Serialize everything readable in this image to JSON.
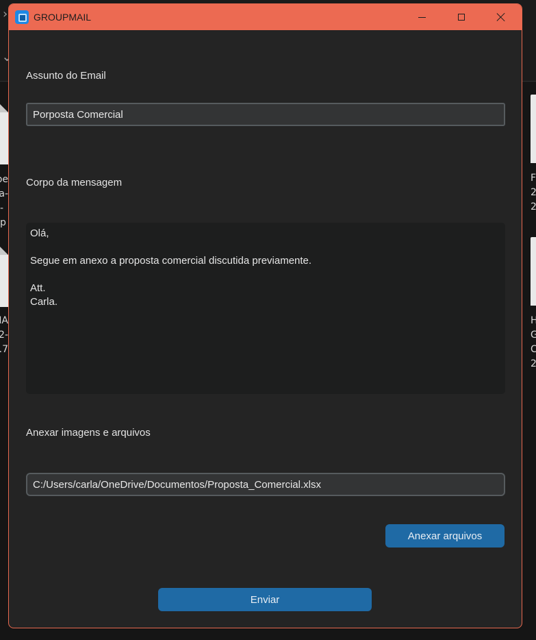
{
  "window": {
    "title": "GROUPMAIL"
  },
  "form": {
    "subject_label": "Assunto do Email",
    "subject_value": "Porposta Comercial",
    "body_label": "Corpo da mensagem",
    "body_value": "Olá,\n\nSegue em anexo a proposta comercial discutida previamente.\n\nAtt.\nCarla.",
    "attach_label": "Anexar imagens e arquivos",
    "attach_path": "C:/Users/carla/OneDrive/Documentos/Proposta_Comercial.xlsx",
    "attach_button": "Anexar arquivos",
    "send_button": "Enviar"
  },
  "background": {
    "left_texts": [
      "pe\n-sa\n-\np",
      "MA\n-2\n7."
    ],
    "right_texts": [
      "F\n2\n2",
      "H\nG\nC\n2"
    ]
  },
  "colors": {
    "titlebar": "#ec6a52",
    "window_bg": "#242424",
    "button_bg": "#1f6aa5"
  }
}
